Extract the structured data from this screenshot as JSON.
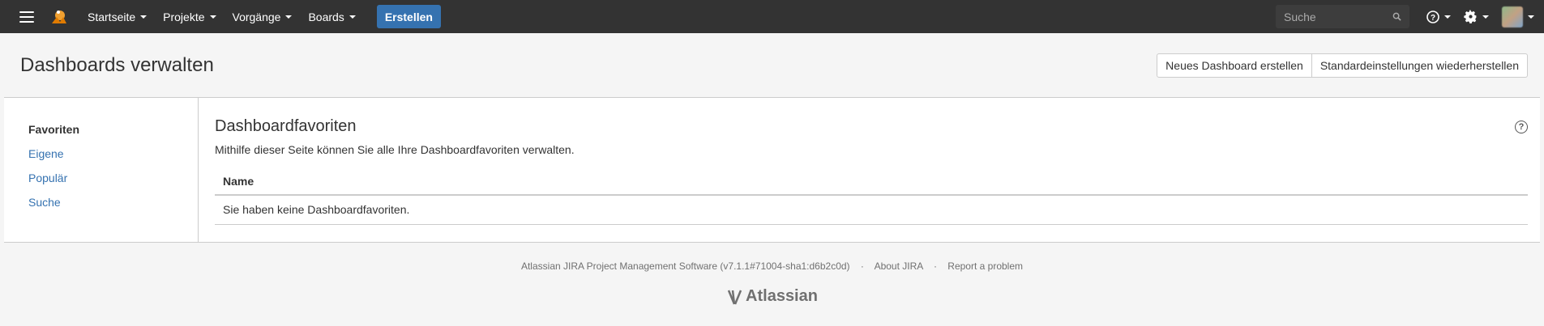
{
  "nav": {
    "items": [
      {
        "label": "Startseite"
      },
      {
        "label": "Projekte"
      },
      {
        "label": "Vorgänge"
      },
      {
        "label": "Boards"
      }
    ],
    "create_label": "Erstellen",
    "search_placeholder": "Suche"
  },
  "header": {
    "title": "Dashboards verwalten",
    "new_dashboard_label": "Neues Dashboard erstellen",
    "restore_defaults_label": "Standardeinstellungen wiederherstellen"
  },
  "sidebar": {
    "items": [
      {
        "label": "Favoriten",
        "active": true
      },
      {
        "label": "Eigene",
        "active": false
      },
      {
        "label": "Populär",
        "active": false
      },
      {
        "label": "Suche",
        "active": false
      }
    ]
  },
  "main": {
    "title": "Dashboardfavoriten",
    "description": "Mithilfe dieser Seite können Sie alle Ihre Dashboardfavoriten verwalten.",
    "table": {
      "column_name": "Name",
      "empty_message": "Sie haben keine Dashboardfavoriten."
    }
  },
  "footer": {
    "version_text": "Atlassian JIRA Project Management Software (v7.1.1#71004-sha1:d6b2c0d)",
    "separator": "·",
    "about_label": "About JIRA",
    "report_label": "Report a problem",
    "logo_text": "Atlassian"
  },
  "colors": {
    "topnav_bg": "#333333",
    "accent": "#3572b0",
    "link": "#3572b0"
  }
}
